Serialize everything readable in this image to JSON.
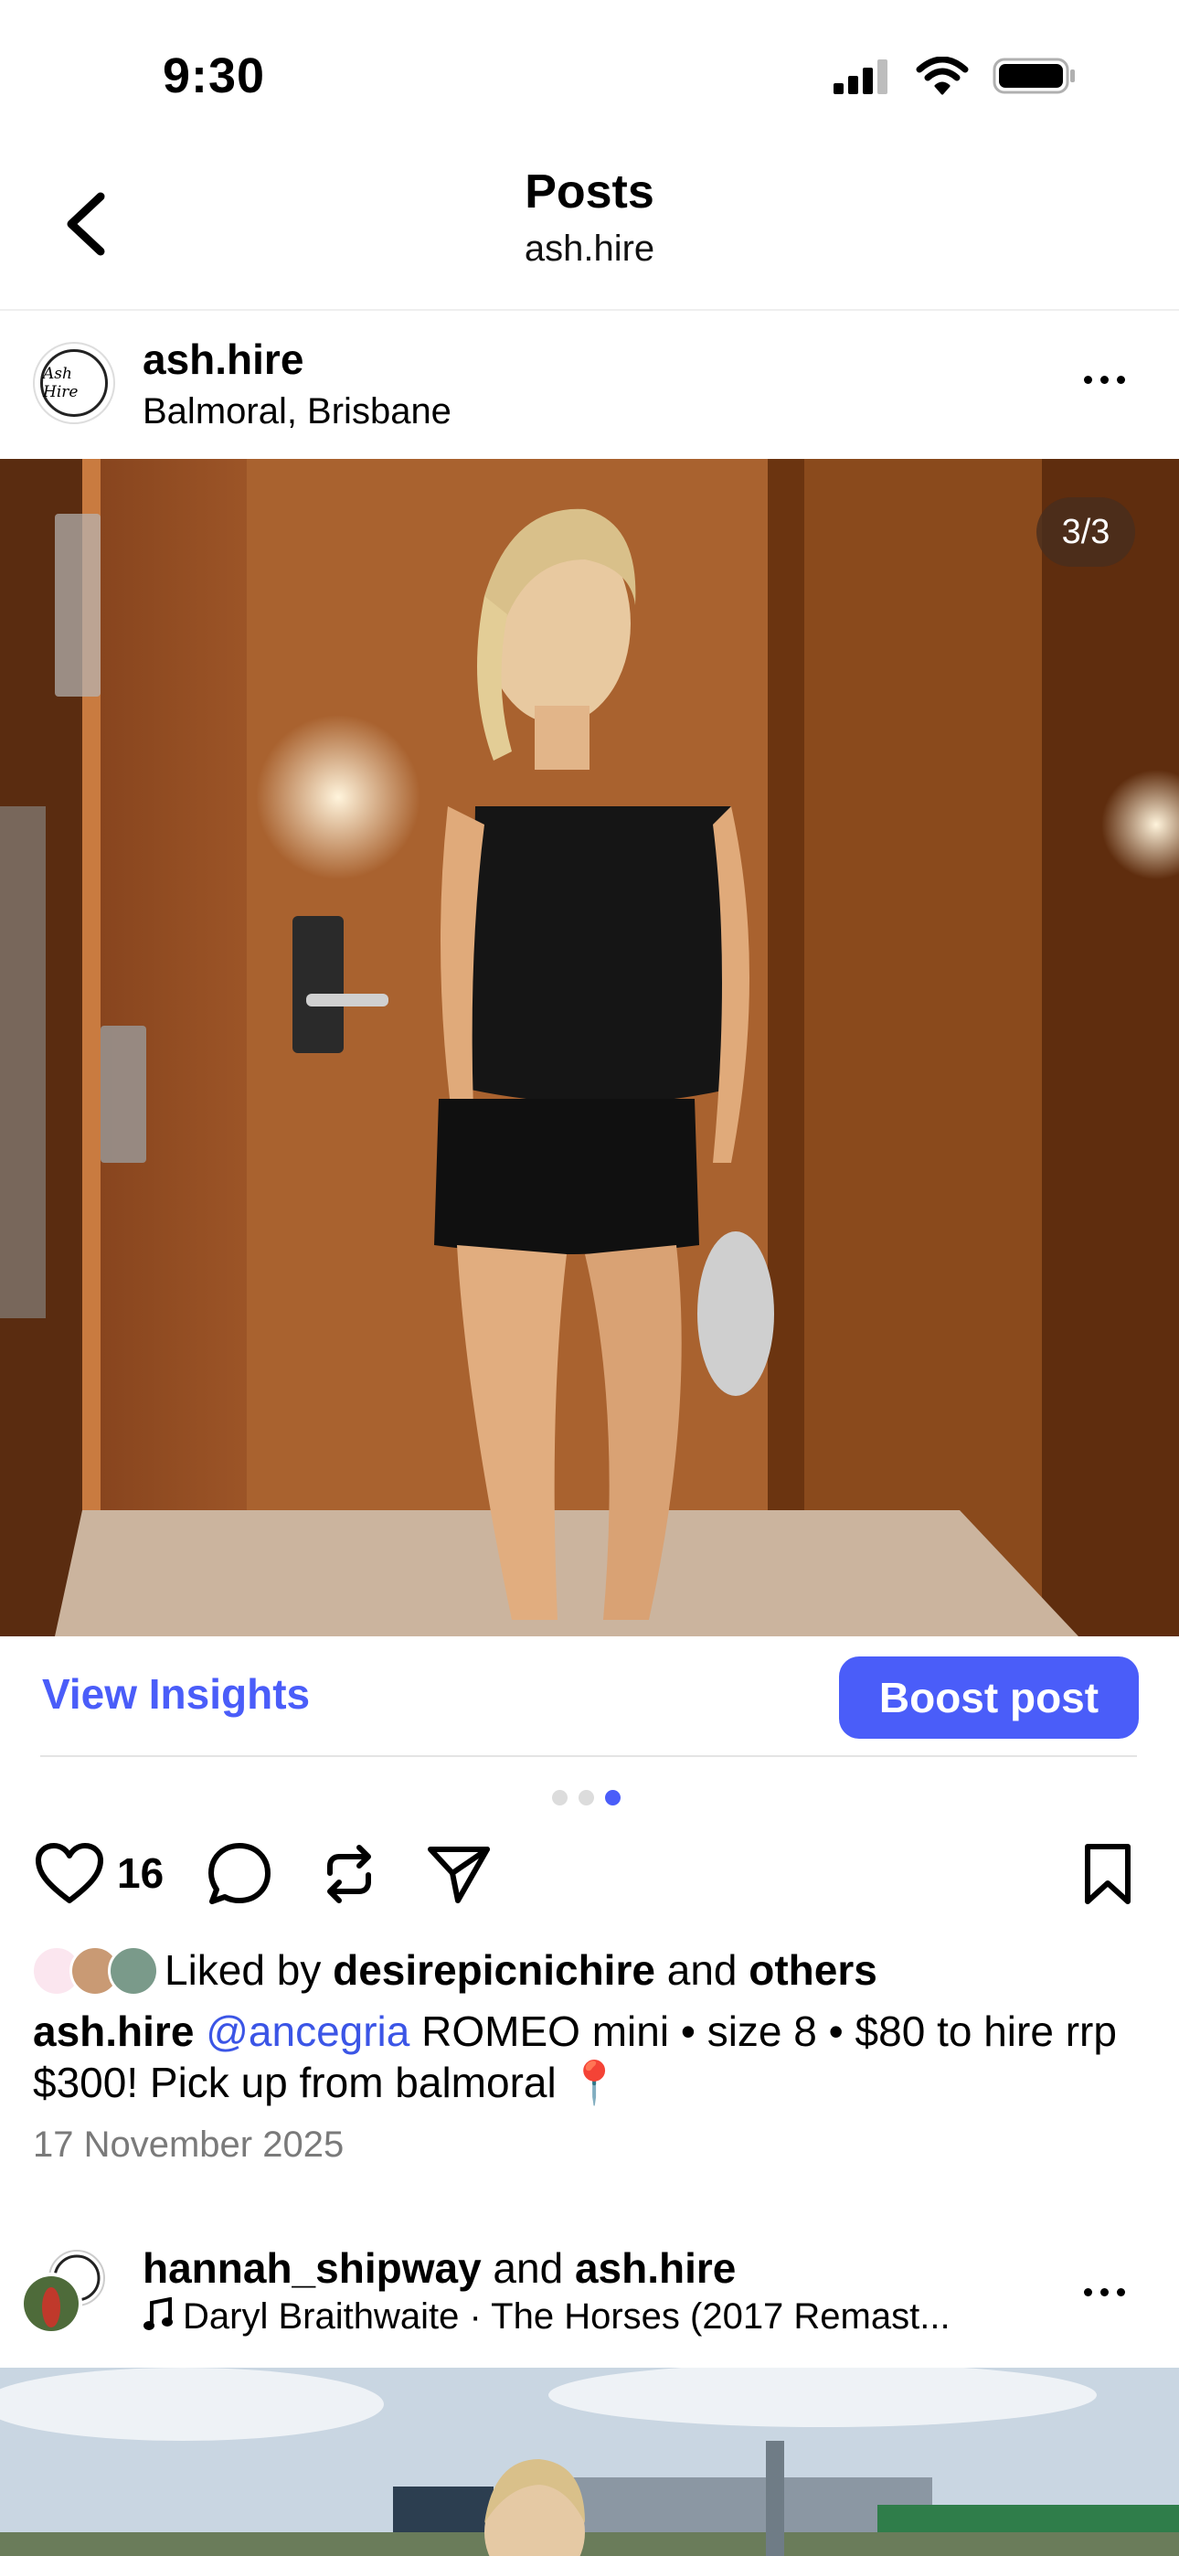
{
  "status_bar": {
    "time": "9:30",
    "icons": [
      "cellular-signal-icon",
      "wifi-icon",
      "battery-icon"
    ]
  },
  "header": {
    "back_icon": "chevron-left-icon",
    "title": "Posts",
    "subtitle": "ash.hire"
  },
  "post": {
    "avatar_text": "Ash Hire",
    "username": "ash.hire",
    "location": "Balmoral, Brisbane",
    "more_icon": "more-horizontal-icon",
    "image_counter": "3/3",
    "image_description_icon": "photo",
    "view_insights_label": "View Insights",
    "boost_label": "Boost post",
    "carousel": {
      "count": 3,
      "active_index": 2
    },
    "actions": {
      "like_icon": "heart-icon",
      "like_count": "16",
      "comment_icon": "comment-icon",
      "repost_icon": "repost-icon",
      "share_icon": "send-icon",
      "save_icon": "bookmark-icon"
    },
    "liked_by": {
      "prefix": "Liked by ",
      "user": "desirepicnichire",
      "conjunction": " and ",
      "others": "others"
    },
    "caption": {
      "username": "ash.hire",
      "mention": "@ancegria",
      "text": " ROMEO mini • size 8 • $80 to hire rrp $300! Pick up from balmoral 📍"
    },
    "date": "17 November 2025"
  },
  "next_post": {
    "user1": "hannah_shipway",
    "conjunction": " and ",
    "user2": "ash.hire",
    "audio_icon": "music-note-icon",
    "audio": "Daryl Braithwaite · The Horses (2017 Remast..."
  },
  "colors": {
    "accent": "#4a5df9",
    "mention": "#3b55e6",
    "date_gray": "#7a7a7a"
  }
}
